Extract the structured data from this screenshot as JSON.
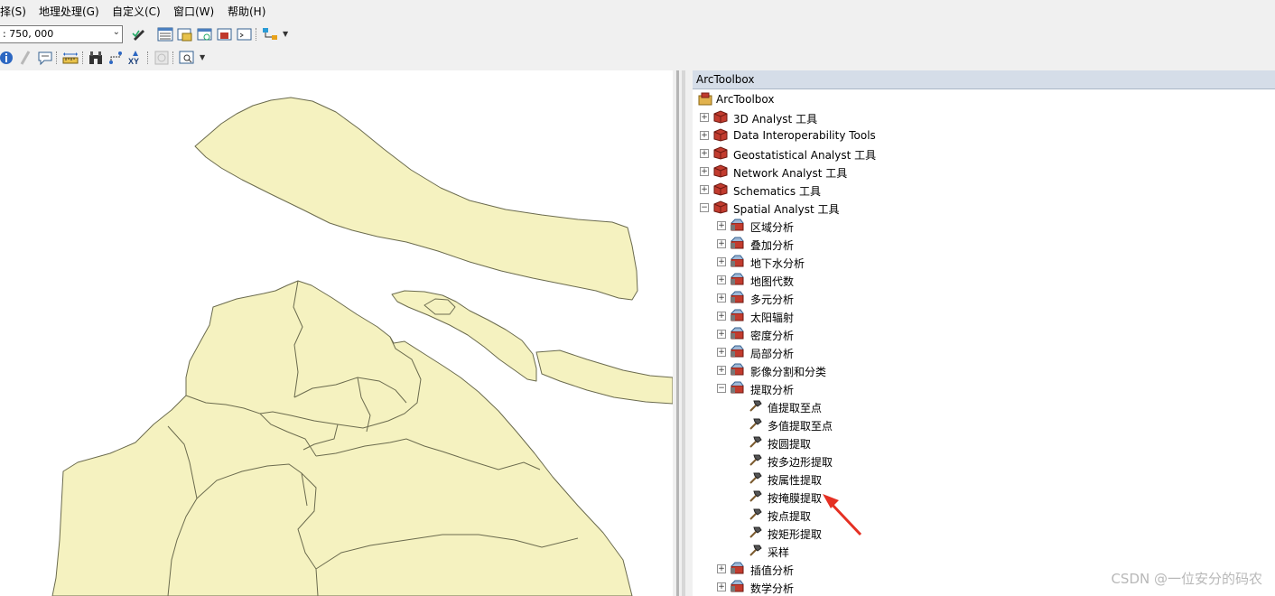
{
  "menubar": {
    "items": [
      "择(S)",
      "地理处理(G)",
      "自定义(C)",
      "窗口(W)",
      "帮助(H)"
    ]
  },
  "toolbar": {
    "scale_value": ": 750, 000"
  },
  "arctoolbox": {
    "panel_title": "ArcToolbox",
    "root_label": "ArcToolbox",
    "toolboxes": [
      {
        "label": "3D Analyst 工具",
        "expanded": false
      },
      {
        "label": "Data Interoperability Tools",
        "expanded": false
      },
      {
        "label": "Geostatistical Analyst 工具",
        "expanded": false
      },
      {
        "label": "Network Analyst 工具",
        "expanded": false
      },
      {
        "label": "Schematics 工具",
        "expanded": false
      },
      {
        "label": "Spatial Analyst 工具",
        "expanded": true
      }
    ],
    "spatial_toolsets": [
      "区域分析",
      "叠加分析",
      "地下水分析",
      "地图代数",
      "多元分析",
      "太阳辐射",
      "密度分析",
      "局部分析",
      "影像分割和分类",
      "提取分析"
    ],
    "extraction_tools": [
      "值提取至点",
      "多值提取至点",
      "按圆提取",
      "按多边形提取",
      "按属性提取",
      "按掩膜提取",
      "按点提取",
      "按矩形提取",
      "采样"
    ],
    "more_toolsets": [
      "插值分析",
      "数学分析"
    ]
  },
  "watermark": "CSDN @一位安分的码农",
  "colors": {
    "map_fill": "#f5f2c0",
    "map_stroke": "#6b6b4e",
    "toolbox_red": "#c0392b",
    "arrow_red": "#e53023"
  }
}
